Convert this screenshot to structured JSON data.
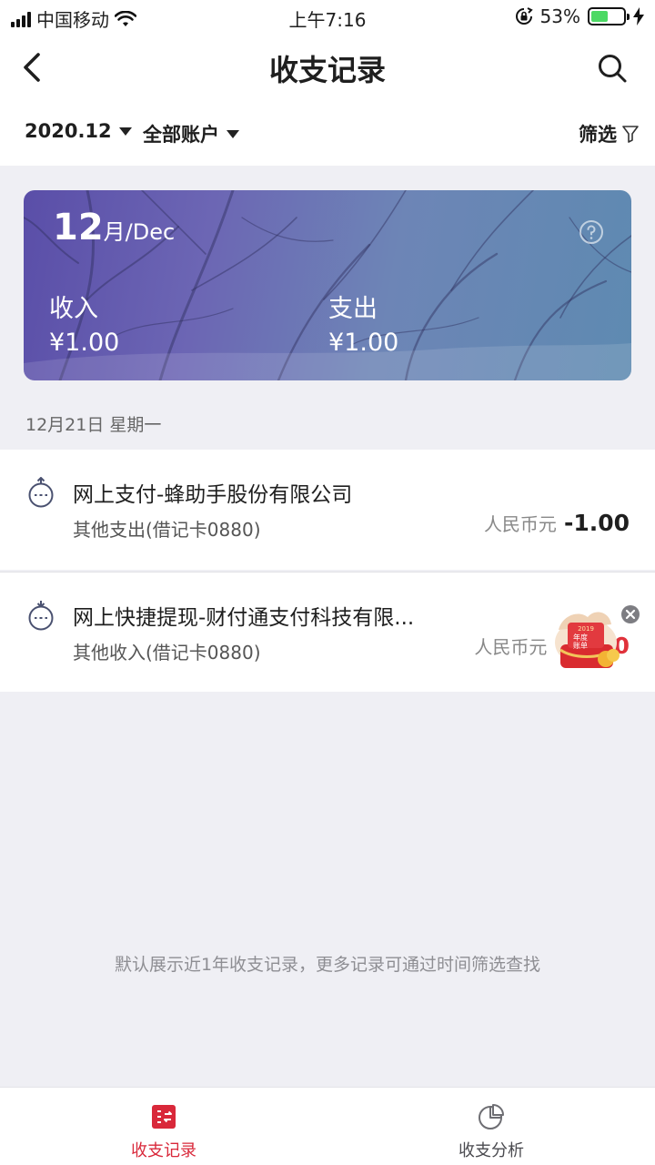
{
  "status": {
    "carrier": "中国移动",
    "time": "上午7:16",
    "battery_pct": "53%",
    "battery_level": 0.53,
    "colors": {
      "battery_fill": "#4cd964"
    }
  },
  "nav": {
    "title": "收支记录",
    "back_icon": "chevron-left-icon",
    "search_icon": "search-icon"
  },
  "filters": {
    "month": "2020.12",
    "account": "全部账户",
    "filter_label": "筛选"
  },
  "summary": {
    "month_num": "12",
    "month_suffix": "月/Dec",
    "income_label": "收入",
    "income_value": "¥1.00",
    "expense_label": "支出",
    "expense_value": "¥1.00"
  },
  "date_header": "12月21日 星期一",
  "transactions": [
    {
      "title": "网上支付-蜂助手股份有限公司",
      "subtitle": "其他支出(借记卡0880)",
      "currency": "人民币元",
      "amount": "-1.00",
      "type": "expense",
      "icon": "expense-clock-icon"
    },
    {
      "title": "网上快捷提现-财付通支付科技有限...",
      "subtitle": "其他收入(借记卡0880)",
      "currency": "人民币元",
      "amount": "+1.00",
      "type": "income",
      "icon": "income-clock-icon"
    }
  ],
  "promo": {
    "year": "2019",
    "line1": "年度",
    "line2": "账单"
  },
  "footer_note": "默认展示近1年收支记录，更多记录可通过时间筛选查找",
  "tabs": [
    {
      "label": "收支记录",
      "icon": "ledger-icon",
      "active": true
    },
    {
      "label": "收支分析",
      "icon": "pie-chart-icon",
      "active": false
    }
  ],
  "colors": {
    "accent": "#d9283a",
    "income": "#e0323b",
    "banner_start": "#5a4ea8",
    "banner_end": "#5e8ab1"
  }
}
